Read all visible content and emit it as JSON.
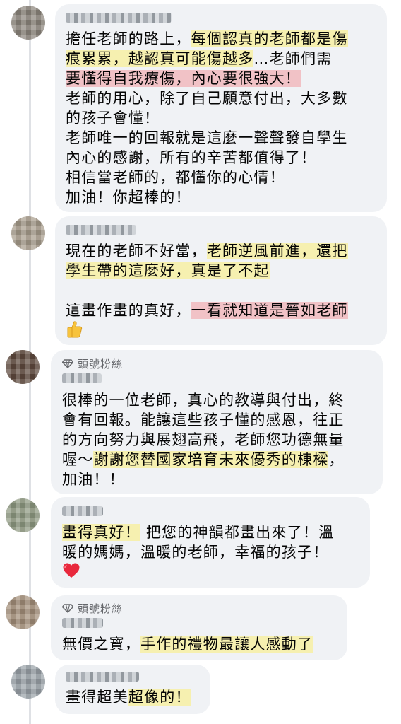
{
  "comments": [
    {
      "lines": [
        [
          {
            "t": "擔任老師的路上，",
            "h": ""
          },
          {
            "t": "每個認真的老師都是傷",
            "h": "y"
          }
        ],
        [
          {
            "t": "痕累累，越認真可能傷越多",
            "h": "y"
          },
          {
            "t": "…老師們需",
            "h": ""
          }
        ],
        [
          {
            "t": "要懂得自我療傷，內心要很強大！",
            "h": "r"
          }
        ],
        [
          {
            "t": "老師的用心，除了自己願意付出，大多數",
            "h": ""
          }
        ],
        [
          {
            "t": "的孩子會懂！",
            "h": ""
          }
        ],
        [
          {
            "t": "老師唯一的回報就是這麼一聲聲發自學生",
            "h": ""
          }
        ],
        [
          {
            "t": "內心的感謝，所有的辛苦都值得了！",
            "h": ""
          }
        ],
        [
          {
            "t": "相信當老師的，都懂你的心情！",
            "h": ""
          }
        ],
        [
          {
            "t": "加油！你超棒的！",
            "h": ""
          }
        ]
      ]
    },
    {
      "lines": [
        [
          {
            "t": "現在的老師不好當，",
            "h": ""
          },
          {
            "t": "老師逆風前進，還把",
            "h": "y"
          }
        ],
        [
          {
            "t": "學生帶的這麼好，真是了不起",
            "h": "y"
          }
        ],
        [
          {
            "t": "",
            "h": ""
          }
        ],
        [
          {
            "t": "這畫作畫的真好，",
            "h": ""
          },
          {
            "t": "一看就知道是晉如老師",
            "h": "r"
          }
        ]
      ],
      "emoji": "thumbs-up-icon"
    },
    {
      "badge": "頭號粉絲",
      "lines": [
        [
          {
            "t": "很棒的一位老師，真心的教導與付出，終",
            "h": ""
          }
        ],
        [
          {
            "t": "會有回報。能讓這些孩子懂的感恩，往正",
            "h": ""
          }
        ],
        [
          {
            "t": "的方向努力與展翅高飛，老師您功德無量",
            "h": ""
          }
        ],
        [
          {
            "t": "喔～",
            "h": ""
          },
          {
            "t": "謝謝您替國家培育未來優秀的棟樑",
            "h": "y"
          },
          {
            "t": "，",
            "h": ""
          }
        ],
        [
          {
            "t": "加油！！",
            "h": ""
          }
        ]
      ]
    },
    {
      "lines": [
        [
          {
            "t": "畫得真好！",
            "h": "y"
          },
          {
            "t": "  把您的神韻都畫出來了！溫",
            "h": ""
          }
        ],
        [
          {
            "t": "暖的媽媽，溫暖的老師，幸福的孩子！",
            "h": ""
          }
        ]
      ],
      "emoji": "red-heart-icon"
    },
    {
      "badge": "頭號粉絲",
      "lines": [
        [
          {
            "t": "無價之寶，",
            "h": ""
          },
          {
            "t": "手作的禮物最讓人感動了",
            "h": "y"
          }
        ]
      ]
    },
    {
      "lines": [
        [
          {
            "t": "畫得超美",
            "h": ""
          },
          {
            "t": "超像的！",
            "h": "y"
          }
        ]
      ]
    }
  ],
  "colors": {
    "bubble": "#f0f2f5",
    "highlight_yellow": "#f6f0b0",
    "highlight_red": "#f1c2c6",
    "text": "#050505",
    "badge_text": "#65676b"
  }
}
